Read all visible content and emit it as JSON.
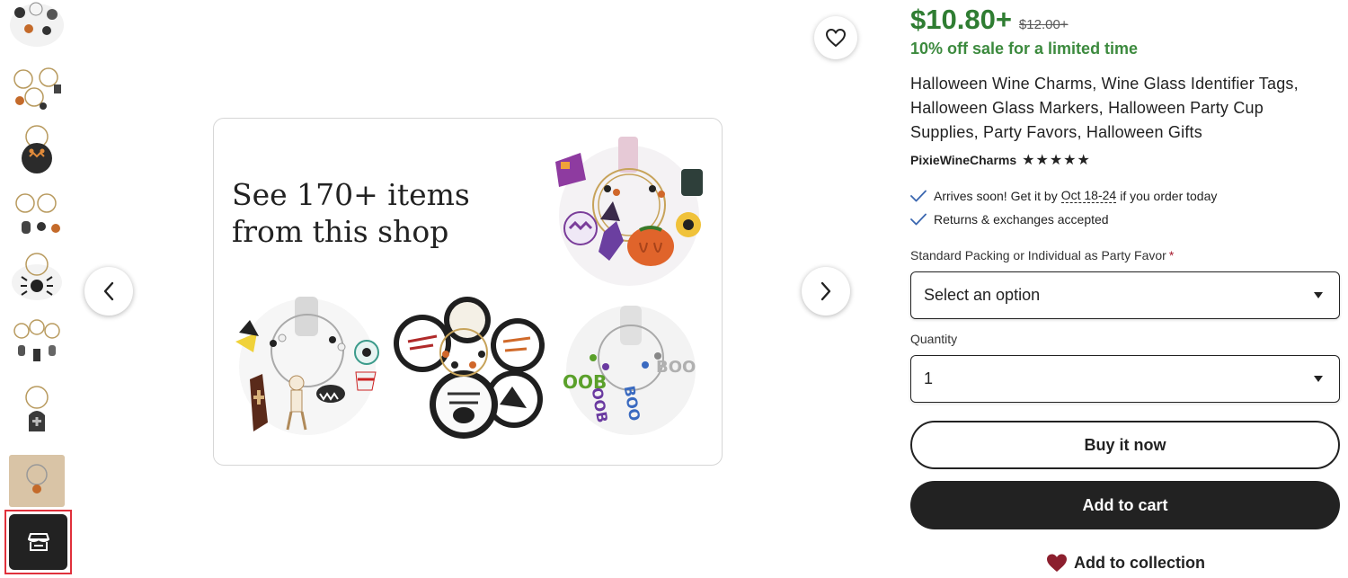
{
  "gallery": {
    "thumbnails": [
      {
        "label": "Thumbnail 1"
      },
      {
        "label": "Thumbnail 2"
      },
      {
        "label": "Thumbnail 3"
      },
      {
        "label": "Thumbnail 4"
      },
      {
        "label": "Thumbnail 5"
      },
      {
        "label": "Thumbnail 6"
      },
      {
        "label": "Thumbnail 7"
      },
      {
        "label": "Thumbnail 8"
      }
    ],
    "shop_thumb_icon": "storefront-icon",
    "shop_card": {
      "title": "See 170+ items from this shop"
    },
    "icons": {
      "favorite": "heart-outline-icon",
      "prev": "chevron-left-icon",
      "next": "chevron-right-icon"
    }
  },
  "listing": {
    "price": "$10.80+",
    "original_price": "$12.00+",
    "sale_note": "10% off sale for a limited time",
    "title": "Halloween Wine Charms, Wine Glass Identifier Tags, Halloween Glass Markers, Halloween Party Cup Supplies, Party Favors, Halloween Gifts",
    "shop_name": "PixieWineCharms",
    "rating_stars": "★★★★★",
    "rating": 5,
    "delivery": {
      "prefix": "Arrives soon! Get it by",
      "date": "Oct 18-24",
      "suffix": "if you order today"
    },
    "returns": "Returns & exchanges accepted",
    "option_label": "Standard Packing or Individual as Party Favor",
    "required_mark": "*",
    "option_select": "Select an option",
    "quantity_label": "Quantity",
    "quantity_value": "1",
    "buy_now": "Buy it now",
    "add_to_cart": "Add to cart",
    "add_to_collection": "Add to collection"
  },
  "colors": {
    "sale_green": "#2f7d32",
    "button_dark": "#222222",
    "collection_heart": "#8c1f2e",
    "selected_thumb_border": "#e0303b"
  }
}
